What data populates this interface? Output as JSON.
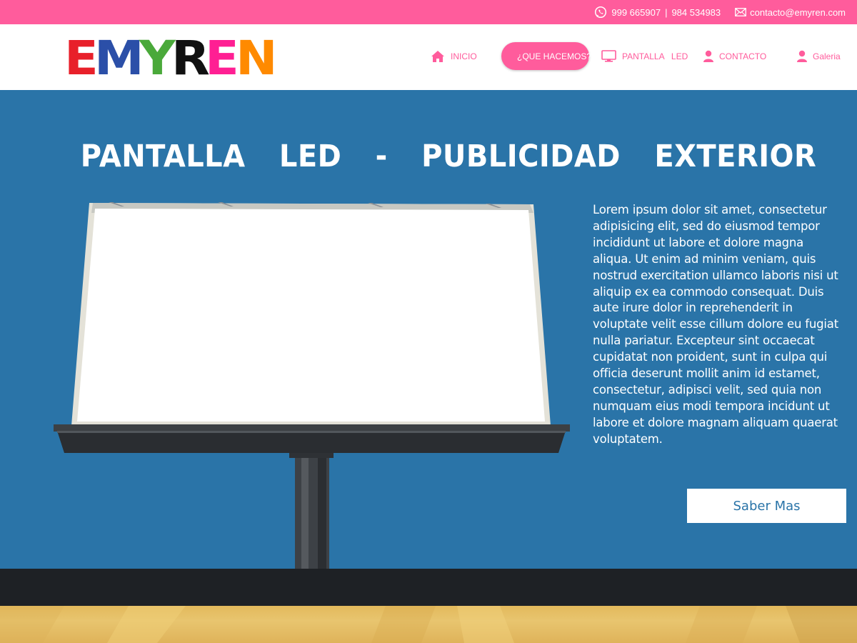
{
  "topbar": {
    "phone_1": "999 665907",
    "separator": "|",
    "phone_2": "984 534983",
    "email": "contacto@emyren.com"
  },
  "brand": {
    "logo_letters": [
      "E",
      "M",
      "Y",
      "R",
      "E",
      "N"
    ],
    "logo_colors": [
      "#e8202a",
      "#2b4fa8",
      "#4aa93a",
      "#111111",
      "#ff1f93",
      "#ff8a00"
    ]
  },
  "nav": {
    "items": [
      {
        "label": "INICIO",
        "icon": "home-icon"
      },
      {
        "label": "¿QUE HACEMOS?",
        "icon": "database-icon",
        "active": true
      },
      {
        "label": "PANTALLA   LED",
        "icon": "monitor-icon"
      },
      {
        "label": "CONTACTO",
        "icon": "user-icon"
      },
      {
        "label": "Galeria",
        "icon": "user-icon"
      }
    ]
  },
  "hero": {
    "title": "PANTALLA  LED  -  PUBLICIDAD  EXTERIOR",
    "body": "Lorem ipsum dolor sit amet, consectetur adipisicing elit, sed do eiusmod tempor incididunt ut labore et dolore magna aliqua. Ut enim ad minim veniam, quis nostrud exercitation ullamco laboris nisi ut aliquip ex ea commodo consequat. Duis aute irure dolor in reprehenderit in voluptate velit esse cillum dolore eu fugiat nulla pariatur. Excepteur sint occaecat cupidatat non proident, sunt in culpa qui officia deserunt mollit anim id estamet, consectetur, adipisci velit, sed quia non numquam eius modi tempora incidunt ut labore et dolore magnam aliquam quaerat voluptatem.",
    "button_label": "Saber Mas"
  },
  "colors": {
    "accent_pink": "#ff5c9c",
    "hero_blue": "#2a74a8",
    "dark_strip": "#1e2125",
    "yellow_strip": "#e5bd62"
  }
}
